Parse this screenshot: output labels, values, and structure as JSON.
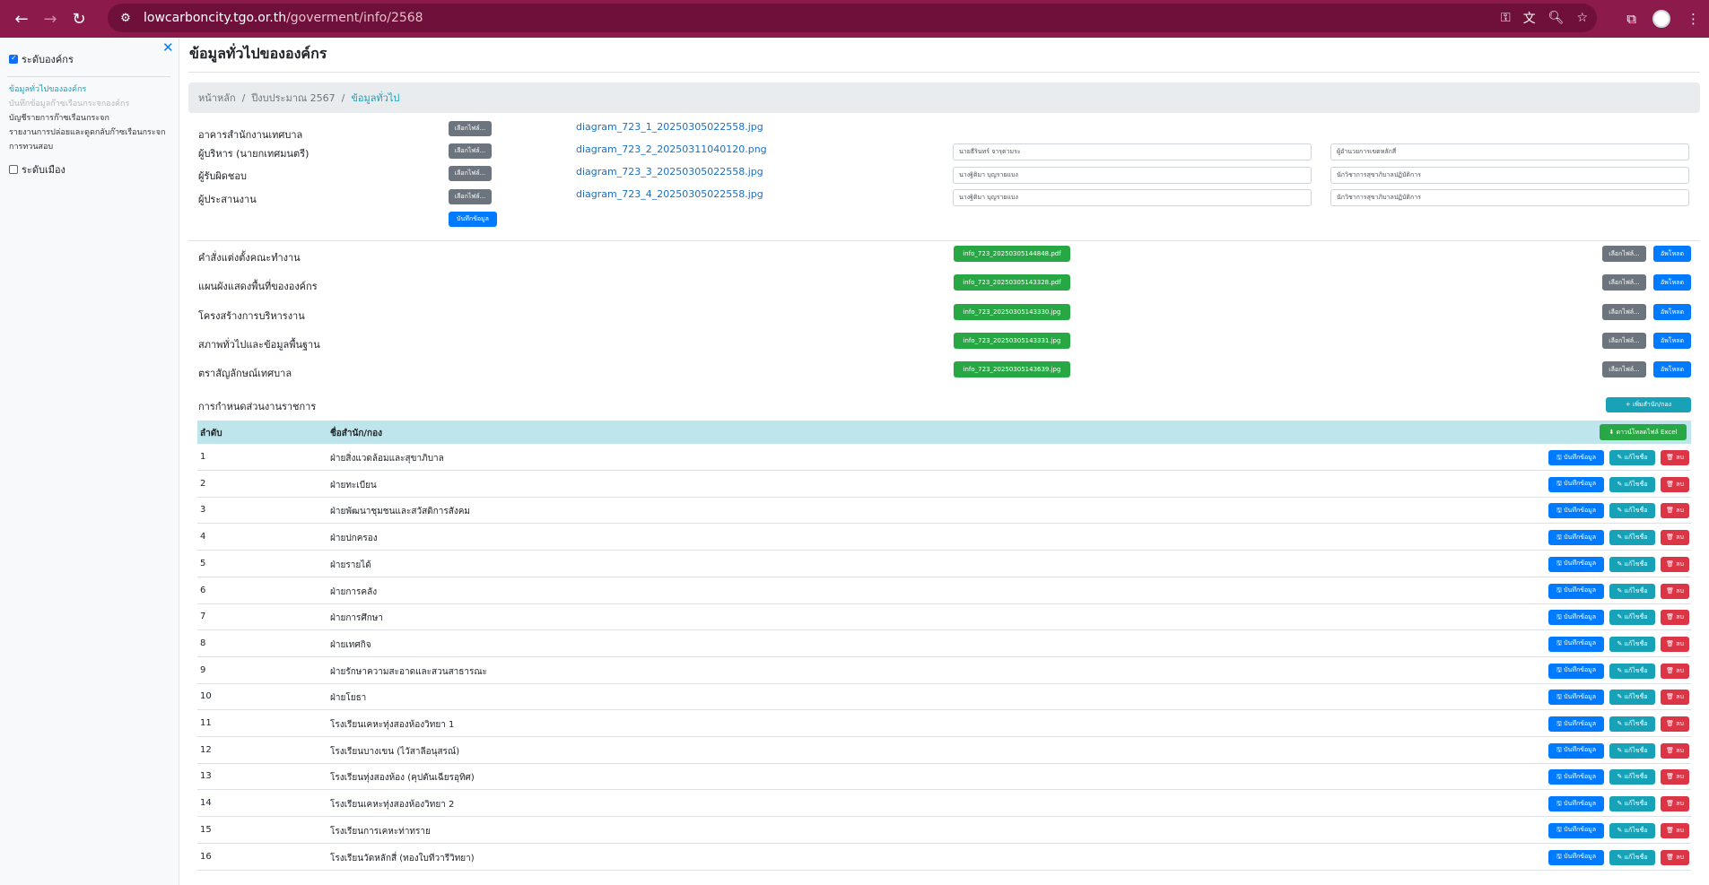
{
  "browser": {
    "url_host": "lowcarboncity.tgo.or.th",
    "url_path": "/goverment/info/2568"
  },
  "sidebar": {
    "org_level_label": "ระดับองค์กร",
    "city_level_label": "ระดับเมือง",
    "links": [
      "ข้อมูลทั่วไปขององค์กร",
      "บันทึกข้อมูลก๊าซเรือนกระจกองค์กร",
      "บัญชีรายการก๊าซเรือนกระจก",
      "รายงานการปล่อยและดูดกลับก๊าซเรือนกระจก",
      "การทวนสอบ"
    ]
  },
  "main": {
    "title": "ข้อมูลทั่วไปขององค์กร",
    "breadcrumb": [
      "หน้าหลัก",
      "ปีงบประมาณ 2567",
      "ข้อมูลทั่วไป"
    ],
    "choose_file_label": "เลือกไฟล์...",
    "save_label": "บันทึกข้อมูล",
    "upload_label": "อัพโหลด",
    "people": [
      {
        "label": "อาคารสำนักงานเทศบาล",
        "file": "diagram_723_1_20250305022558.jpg",
        "name": "",
        "position": ""
      },
      {
        "label": "ผู้บริหาร (นายกเทศมนตรี)",
        "file": "diagram_723_2_20250311040120.png",
        "name": "นายธีรินทร์ จารุตามระ",
        "position": "ผู้อำนวยการเขตหลักสี่"
      },
      {
        "label": "ผู้รับผิดชอบ",
        "file": "diagram_723_3_20250305022558.jpg",
        "name": "นางฐิติมา บุญรายแบง",
        "position": "นักวิชาการสุขาภิบาลปฏิบัติการ"
      },
      {
        "label": "ผู้ประสานงาน",
        "file": "diagram_723_4_20250305022558.jpg",
        "name": "นางฐิติมา บุญรายแบง",
        "position": "นักวิชาการสุขาภิบาลปฏิบัติการ"
      }
    ],
    "documents": [
      {
        "label": "คำสั่งแต่งตั้งคณะทำงาน",
        "file": "info_723_20250305144848.pdf"
      },
      {
        "label": "แผนผังแสดงพื้นที่ขององค์กร",
        "file": "info_723_20250305143328.pdf"
      },
      {
        "label": "โครงสร้างการบริหารงาน",
        "file": "info_723_20250305143330.jpg"
      },
      {
        "label": "สภาพทั่วไปและข้อมูลพื้นฐาน",
        "file": "info_723_20250305143331.jpg"
      },
      {
        "label": "ตราสัญลักษณ์เทศบาล",
        "file": "info_723_20250305143639.jpg"
      }
    ],
    "divisions_label": "การกำหนดส่วนงานราชการ",
    "add_division_label": "+ เพิ่มสำนัก/กอง",
    "download_excel_label": "⬇ ดาวน์โหลดไฟล์ Excel",
    "table_headers": {
      "no": "ลำดับ",
      "name": "ชื่อสำนัก/กอง"
    },
    "row_actions": {
      "save": "🖫 บันทึกข้อมูล",
      "edit": "✎ แก้ไขชื่อ",
      "delete": "🗑 ลบ"
    },
    "divisions": [
      {
        "no": "1",
        "name": "ฝ่ายสิ่งแวดล้อมและสุขาภิบาล"
      },
      {
        "no": "2",
        "name": "ฝ่ายทะเบียน"
      },
      {
        "no": "3",
        "name": "ฝ่ายพัฒนาชุมชนและสวัสดิการสังคม"
      },
      {
        "no": "4",
        "name": "ฝ่ายปกครอง"
      },
      {
        "no": "5",
        "name": "ฝ่ายรายได้"
      },
      {
        "no": "6",
        "name": "ฝ่ายการคลัง"
      },
      {
        "no": "7",
        "name": "ฝ่ายการศึกษา"
      },
      {
        "no": "8",
        "name": "ฝ่ายเทศกิจ"
      },
      {
        "no": "9",
        "name": "ฝ่ายรักษาความสะอาดและสวนสาธารณะ"
      },
      {
        "no": "10",
        "name": "ฝ่ายโยธา"
      },
      {
        "no": "11",
        "name": "โรงเรียนเคหะทุ่งสองห้องวิทยา 1"
      },
      {
        "no": "12",
        "name": "โรงเรียนบางเขน (ไวัสาลีอนุสรณ์)"
      },
      {
        "no": "13",
        "name": "โรงเรียนทุ่งสองห้อง (คุปตันเฉียรอุทิศ)"
      },
      {
        "no": "14",
        "name": "โรงเรียนเคหะทุ่งสองห้องวิทยา 2"
      },
      {
        "no": "15",
        "name": "โรงเรียนการเคหะท่าทราย"
      },
      {
        "no": "16",
        "name": "โรงเรียนวัดหลักสี่ (ทองใบทีวารีวิทยา)"
      }
    ]
  }
}
